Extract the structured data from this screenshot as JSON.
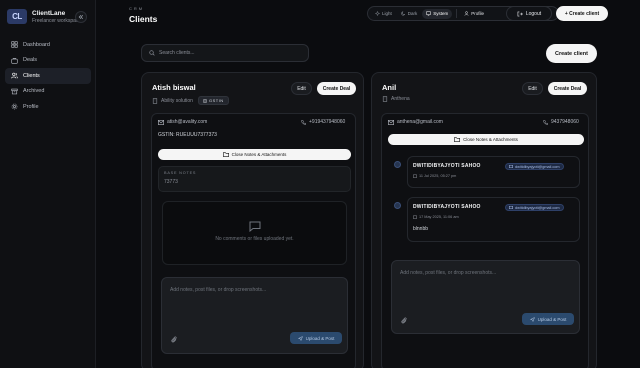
{
  "brand": {
    "logo": "CL",
    "name": "ClientLane",
    "subtitle": "Freelancer workspace"
  },
  "sidebar": {
    "items": [
      {
        "label": "Dashboard",
        "icon": "grid-icon",
        "active": false
      },
      {
        "label": "Deals",
        "icon": "briefcase-icon",
        "active": false
      },
      {
        "label": "Clients",
        "icon": "users-icon",
        "active": true
      },
      {
        "label": "Archived",
        "icon": "archive-icon",
        "active": false
      },
      {
        "label": "Profile",
        "icon": "gear-icon",
        "active": false
      }
    ]
  },
  "header": {
    "crumb": "CRM",
    "title": "Clients",
    "theme": {
      "light": "Light",
      "dark": "Dark",
      "system": "System",
      "selected": "System"
    },
    "profile": "Profile",
    "logout": "Logout",
    "new_client": "+ Create client"
  },
  "search": {
    "placeholder": "Search clients..."
  },
  "create_client": "Create client",
  "clients": [
    {
      "name": "Atish biswal",
      "company": "Ability solution",
      "gstin_badge": "GSTIN",
      "edit": "Edit",
      "create_deal": "Create Deal",
      "email": "atish@avality.com",
      "phone": "+919437948060",
      "gstin_line": "GSTIN: RUEUUU7377373",
      "toggle": "Close Notes & Attachments",
      "base_notes_label": "BASE NOTES",
      "base_notes_value": "73773",
      "empty_text": "No comments or files uploaded yet.",
      "composer_placeholder": "Add notes, post files, or drop screenshots...",
      "upload": "Upload & Post"
    },
    {
      "name": "Anil",
      "company": "Anthena",
      "edit": "Edit",
      "create_deal": "Create Deal",
      "email": "anthena@gmail.com",
      "phone": "9437948060",
      "toggle": "Close Notes & Attachments",
      "notes": [
        {
          "author": "DWITIDIBYAJYOTI SAHOO",
          "email": "dwitidibyajyoti@gmail.com",
          "time": "11 Jul 2025, 05:27 pm",
          "body": ""
        },
        {
          "author": "DWITIDIBYAJYOTI SAHOO",
          "email": "dwitidibyajyoti@gmail.com",
          "time": "17 May 2025, 11:06 am",
          "body": "blnnbb"
        }
      ],
      "composer_placeholder": "Add notes, post files, or drop screenshots...",
      "upload": "Upload & Post"
    }
  ]
}
